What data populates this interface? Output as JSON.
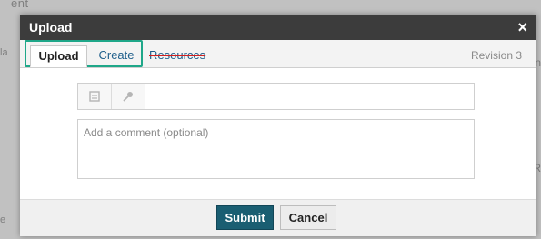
{
  "background": {
    "top_text": "ent",
    "left_fragment_1": "la",
    "left_fragment_2": "e",
    "right_fragment_1": "n",
    "right_fragment_2": "R"
  },
  "dialog": {
    "title": "Upload",
    "close_glyph": "×",
    "tabs": [
      {
        "label": "Upload",
        "active": true
      },
      {
        "label": "Create",
        "active": false
      },
      {
        "label": "Resources",
        "active": false,
        "struck_through": true
      }
    ],
    "highlight_color": "#1fa789",
    "revision_label": "Revision 3",
    "attach_buttons": [
      {
        "icon": "file-icon"
      },
      {
        "icon": "microphone-icon"
      }
    ],
    "comment_placeholder": "Add a comment (optional)",
    "submit_label": "Submit",
    "cancel_label": "Cancel",
    "submit_color": "#1a5e72"
  }
}
